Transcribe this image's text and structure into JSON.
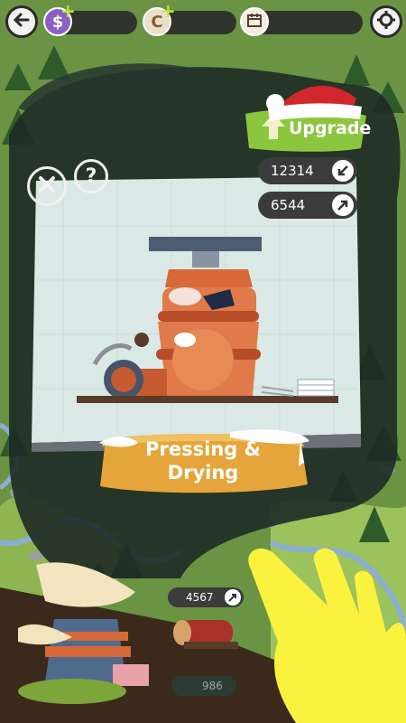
{
  "hud": {
    "back_icon": "back-arrow-icon",
    "currency_cash_icon": "dollar-icon",
    "currency_coin_icon": "c-coin-icon",
    "calendar_icon": "calendar-icon",
    "settings_icon": "gear-icon"
  },
  "panel": {
    "upgrade_label": "Upgrade",
    "stat_in_value": "12314",
    "stat_out_value": "6544",
    "action_label_line1": "Pressing &",
    "action_label_line2": "Drying"
  },
  "map": {
    "building_value": "4567",
    "bottom_value": "986"
  },
  "colors": {
    "upgrade_green": "#8cc63f",
    "action_orange": "#e5a53a",
    "panel_bg": "#dbe9e6",
    "dark_blob": "#1e2a25",
    "hint_hand": "#fbf23f"
  }
}
